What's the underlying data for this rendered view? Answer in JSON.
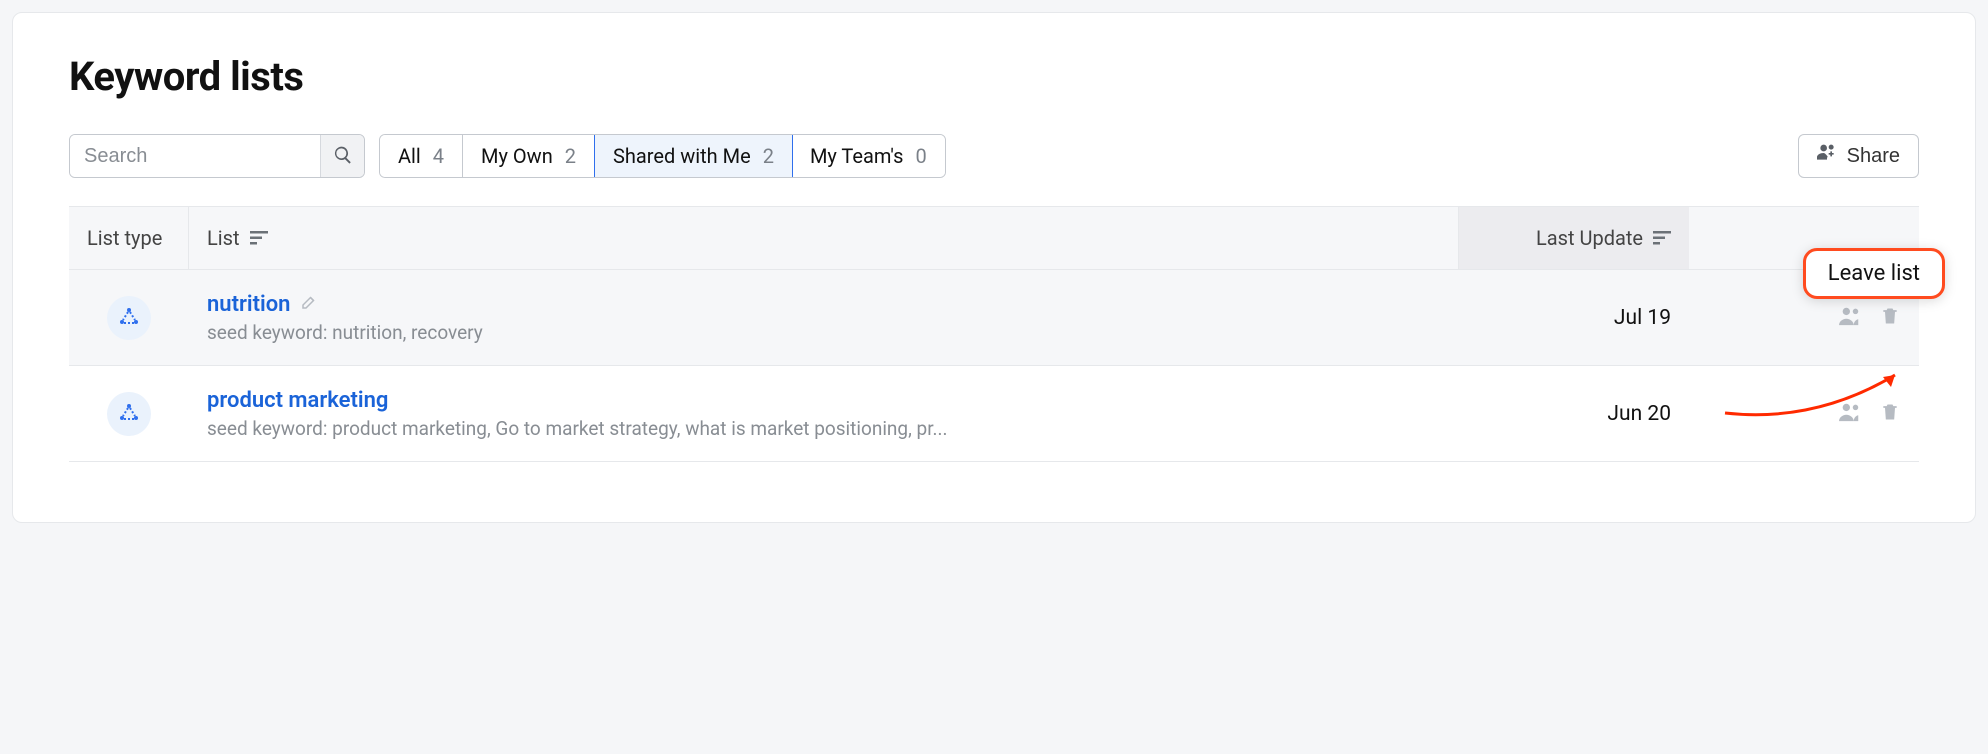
{
  "page": {
    "title": "Keyword lists"
  },
  "search": {
    "placeholder": "Search"
  },
  "filters": [
    {
      "label": "All",
      "count": "4",
      "active": false
    },
    {
      "label": "My Own",
      "count": "2",
      "active": false
    },
    {
      "label": "Shared with Me",
      "count": "2",
      "active": true
    },
    {
      "label": "My Team's",
      "count": "0",
      "active": false
    }
  ],
  "share_label": "Share",
  "columns": {
    "list_type": "List type",
    "list": "List",
    "last_update": "Last Update"
  },
  "rows": [
    {
      "name": "nutrition",
      "seed": "seed keyword: nutrition, recovery",
      "last_update": "Jul 19",
      "hovered": true
    },
    {
      "name": "product marketing",
      "seed": "seed keyword: product marketing, Go to market strategy, what is market positioning, pr...",
      "last_update": "Jun 20",
      "hovered": false
    }
  ],
  "tooltip": {
    "label": "Leave list"
  }
}
